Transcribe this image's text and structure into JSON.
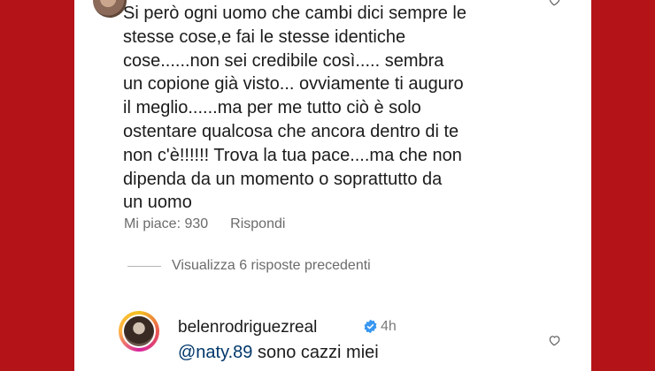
{
  "colors": {
    "frame_red": "#b41417",
    "mention_blue": "#00376b",
    "verified_blue": "#3897f0"
  },
  "comment": {
    "text": "Si però ogni uomo che cambi dici sempre le\nstesse cose,e fai le stesse identiche\ncose......non sei credibile così..... sembra\nun copione già visto... ovviamente ti auguro\nil meglio......ma per me tutto ciò è solo\nostentare qualcosa che ancora dentro di te\nnon c'è!!!!!! Trova la tua pace....ma che non\ndipenda da un momento o soprattutto da\nun uomo",
    "likes_label": "Mi piace: 930",
    "reply_label": "Rispondi"
  },
  "replies_toggle": "Visualizza 6 risposte precedenti",
  "reply": {
    "username": "belenrodriguezreal",
    "time": "4h",
    "mention": "@naty.89",
    "text": " sono cazzi miei"
  },
  "icons": [
    "heart-icon",
    "verified-badge-icon"
  ]
}
